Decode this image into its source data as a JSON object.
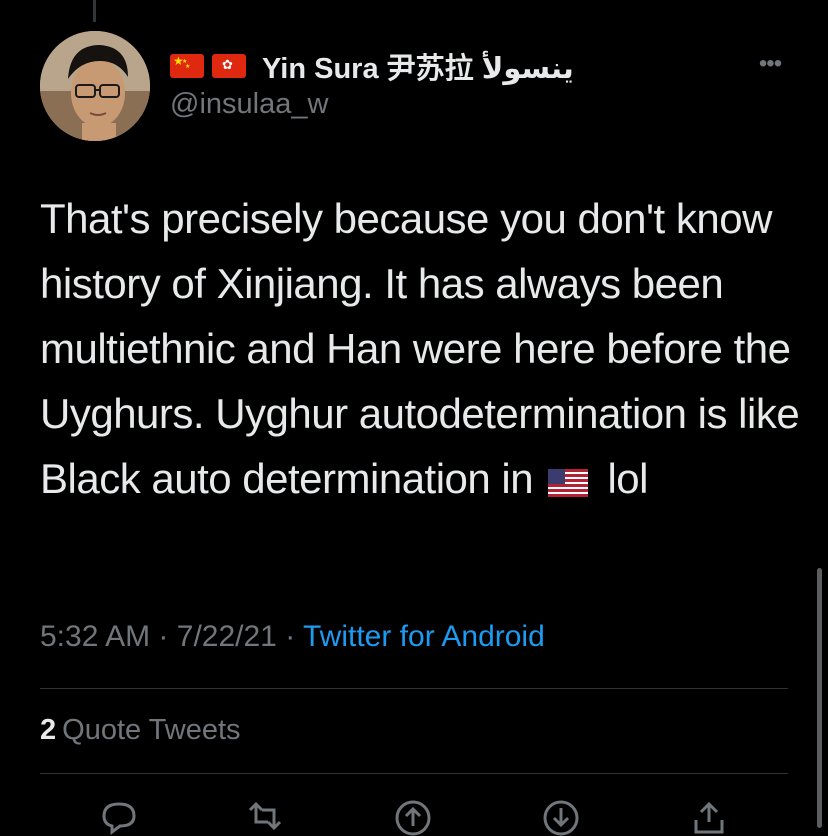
{
  "tweet": {
    "author": {
      "flags": [
        "china-flag-icon",
        "hong-kong-flag-icon"
      ],
      "name_latin": "Yin Sura",
      "name_chinese": "尹苏拉",
      "name_arabic": "ينسولأ",
      "handle": "@insulaa_w"
    },
    "text_before_flag": "That's precisely because you don't know history of Xinjiang. It has always been multiethnic and Han were here before the Uyghurs. Uyghur autodetermination is like Black auto determination in",
    "flag_emoji": "us-flag-icon",
    "text_after_flag": "lol",
    "time": "5:32 AM",
    "separator": "·",
    "date": "7/22/21",
    "source": "Twitter for Android",
    "quote_count": "2",
    "quote_label": "Quote Tweets",
    "actions": [
      "reply-icon",
      "retweet-icon",
      "upvote-icon",
      "downvote-icon",
      "share-icon"
    ]
  },
  "colors": {
    "background": "#000000",
    "text": "#e7e9ea",
    "secondary": "#71767b",
    "link": "#1d9bf0",
    "divider": "#2f3336"
  }
}
